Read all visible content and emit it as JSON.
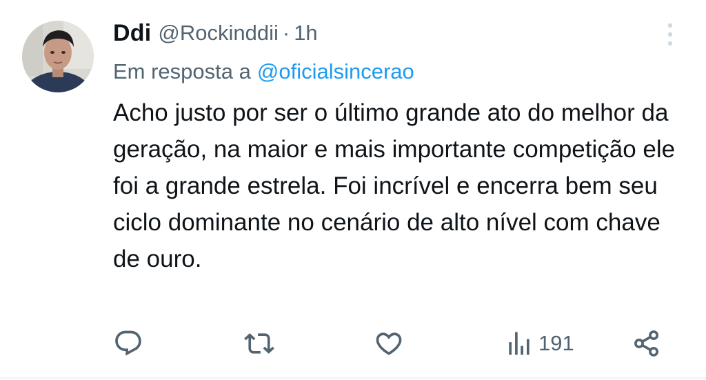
{
  "tweet": {
    "display_name": "Ddi",
    "handle": "@Rockinddii",
    "separator": "·",
    "time": "1h",
    "replying_label": "Em resposta a",
    "replying_handle": "@oficialsincerao",
    "text": "Acho justo por ser o último grande ato do melhor da geração, na maior e mais importante competição ele foi a grande estrela. Foi incrível e encerra bem seu ciclo dominante no cenário de alto nível com chave de ouro.",
    "views": "191"
  },
  "icons": {
    "more": "more-vertical-icon",
    "reply": "reply-icon",
    "retweet": "retweet-icon",
    "like": "heart-icon",
    "views": "views-bar-chart-icon",
    "share": "share-icon"
  },
  "colors": {
    "text_primary": "#0f1419",
    "text_secondary": "#536471",
    "link": "#1d9bf0",
    "icon": "#536471",
    "border": "#eff3f4"
  }
}
